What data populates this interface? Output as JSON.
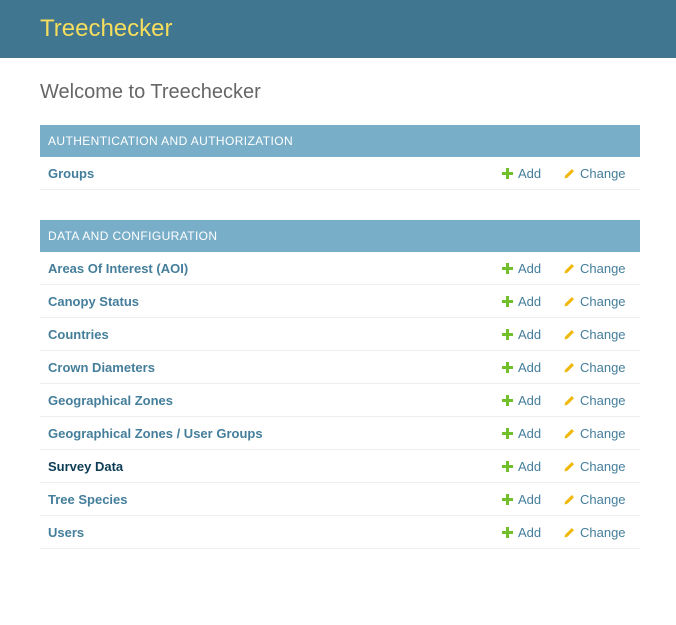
{
  "header": {
    "brand": "Treechecker"
  },
  "page": {
    "title": "Welcome to Treechecker"
  },
  "colors": {
    "header_bg": "#417690",
    "brand": "#f5dd5d",
    "caption_bg": "#79aec8",
    "add_icon": "#70bf2b",
    "change_icon": "#efb80b"
  },
  "actions": {
    "add": "Add",
    "change": "Change"
  },
  "modules": [
    {
      "caption": "Authentication and Authorization",
      "models": [
        {
          "name": "Groups"
        }
      ]
    },
    {
      "caption": "Data and Configuration",
      "models": [
        {
          "name": "Areas Of Interest (AOI)"
        },
        {
          "name": "Canopy Status"
        },
        {
          "name": "Countries"
        },
        {
          "name": "Crown Diameters"
        },
        {
          "name": "Geographical Zones"
        },
        {
          "name": "Geographical Zones / User Groups"
        },
        {
          "name": "Survey Data",
          "visited": true
        },
        {
          "name": "Tree Species"
        },
        {
          "name": "Users"
        }
      ]
    }
  ]
}
